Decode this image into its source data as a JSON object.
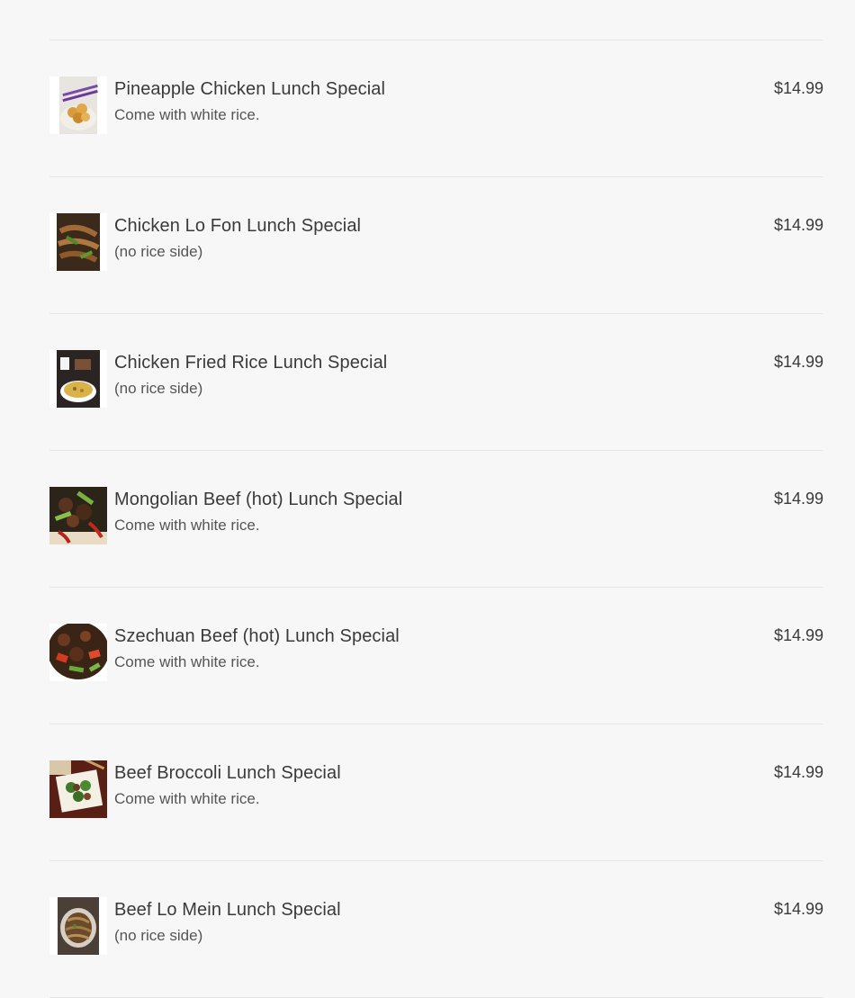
{
  "menu": {
    "items": [
      {
        "name": "Pineapple Chicken Lunch Special",
        "description": "Come with white rice.",
        "price": "$14.99",
        "image_icon": "pineapple-chicken-photo-icon"
      },
      {
        "name": "Chicken Lo Fon Lunch Special",
        "description": "(no rice side)",
        "price": "$14.99",
        "image_icon": "chicken-lo-fon-photo-icon"
      },
      {
        "name": "Chicken Fried Rice Lunch Special",
        "description": "(no rice side)",
        "price": "$14.99",
        "image_icon": "chicken-fried-rice-photo-icon"
      },
      {
        "name": "Mongolian Beef (hot) Lunch Special",
        "description": "Come with white rice.",
        "price": "$14.99",
        "image_icon": "mongolian-beef-photo-icon"
      },
      {
        "name": "Szechuan Beef (hot) Lunch Special",
        "description": "Come with white rice.",
        "price": "$14.99",
        "image_icon": "szechuan-beef-photo-icon"
      },
      {
        "name": "Beef Broccoli Lunch Special",
        "description": "Come with white rice.",
        "price": "$14.99",
        "image_icon": "beef-broccoli-photo-icon"
      },
      {
        "name": "Beef Lo Mein Lunch Special",
        "description": "(no rice side)",
        "price": "$14.99",
        "image_icon": "beef-lo-mein-photo-icon"
      }
    ]
  },
  "colors": {
    "background": "#f7f7f7",
    "divider": "#e6e6e6",
    "text": "#3a3a3a"
  }
}
